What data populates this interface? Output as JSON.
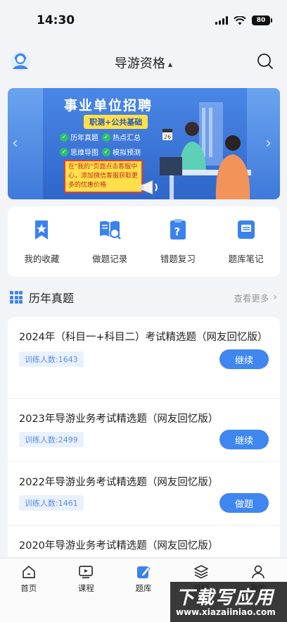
{
  "status": {
    "time": "14:30",
    "battery": "80"
  },
  "header": {
    "title": "导游资格"
  },
  "banner": {
    "title": "事业单位招聘",
    "subtitle": "职测+公共基础",
    "features": [
      "历年真题",
      "热点汇总",
      "思维导图",
      "模拟预测"
    ],
    "calendar_day": "26",
    "note": "在\"我的\"页面点击客服中心，添加微信客服获取更多的优惠价格"
  },
  "actions": [
    {
      "label": "我的收藏",
      "icon": "favorites-icon"
    },
    {
      "label": "做题记录",
      "icon": "record-icon"
    },
    {
      "label": "错题复习",
      "icon": "wrong-review-icon"
    },
    {
      "label": "题库笔记",
      "icon": "notes-icon"
    }
  ],
  "section": {
    "title": "历年真题",
    "more": "查看更多"
  },
  "papers": [
    {
      "title": "2024年（科目一+科目二）考试精选题（网友回忆版）",
      "trainees": "训练人数:1643",
      "button": "继续"
    },
    {
      "title": "2023年导游业务考试精选题（网友回忆版）",
      "trainees": "训练人数:2499",
      "button": "继续"
    },
    {
      "title": "2022年导游业务考试精选题（网友回忆版）",
      "trainees": "训练人数:1461",
      "button": "做题"
    },
    {
      "title": "2020年导游业务考试精选题（网友回忆版）"
    }
  ],
  "tabs": [
    {
      "label": "首页",
      "icon": "home-icon"
    },
    {
      "label": "课程",
      "icon": "course-icon"
    },
    {
      "label": "题库",
      "icon": "question-bank-icon"
    },
    {
      "label": "资料",
      "icon": "materials-icon"
    },
    {
      "label": "我的",
      "icon": "profile-icon"
    }
  ],
  "watermark": {
    "text": "下载写应用",
    "url": "www.xiazaiiniao.com"
  },
  "colors": {
    "accent": "#3f87ee",
    "badge_bg": "#e9f1fd",
    "badge_text": "#5b8ee0"
  }
}
